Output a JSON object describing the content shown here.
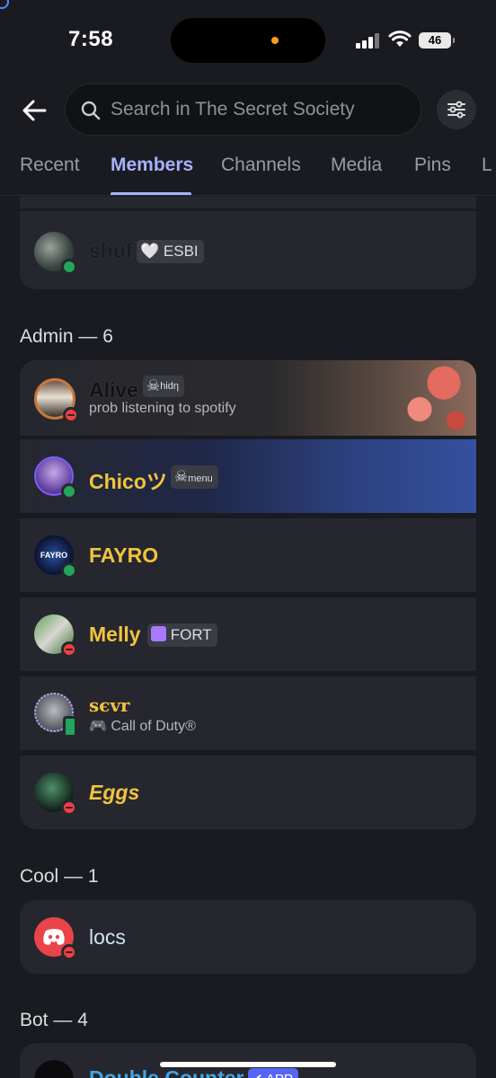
{
  "status_bar": {
    "time": "7:58",
    "battery": "46"
  },
  "search": {
    "placeholder": "Search in The Secret Society"
  },
  "tabs": [
    {
      "label": "Recent"
    },
    {
      "label": "Members"
    },
    {
      "label": "Channels"
    },
    {
      "label": "Media"
    },
    {
      "label": "Pins"
    },
    {
      "label": "L"
    }
  ],
  "top_member": {
    "name": "shuf",
    "tag": "ESBI"
  },
  "sections": {
    "admin": "Admin — 6",
    "cool": "Cool — 1",
    "bot": "Bot — 4"
  },
  "admins": [
    {
      "name": "Alive",
      "tag": "hidη",
      "status_text": "prob listening to spotify",
      "status": "dnd"
    },
    {
      "name": "Chicoツ",
      "tag": "menu",
      "status": "online"
    },
    {
      "name": "FAYRO",
      "avatar_text": "FAYRO",
      "status": "online"
    },
    {
      "name": "Melly",
      "tag": "FORT",
      "status": "dnd"
    },
    {
      "name": "sєvr",
      "activity": "Call of Duty®",
      "status": "mobile"
    },
    {
      "name": "Eggs",
      "status": "dnd"
    }
  ],
  "cool": [
    {
      "name": "locs",
      "status": "dnd"
    }
  ],
  "bots": [
    {
      "name": "Double Counter",
      "badge": "✔ APP"
    }
  ],
  "colors": {
    "background": "#1a1b20",
    "card": "#26272e",
    "accent": "#a6b2ff",
    "admin_name": "#f0c43e",
    "online": "#23a55a",
    "dnd": "#f23f43",
    "bot_name": "#3ea6e8"
  }
}
